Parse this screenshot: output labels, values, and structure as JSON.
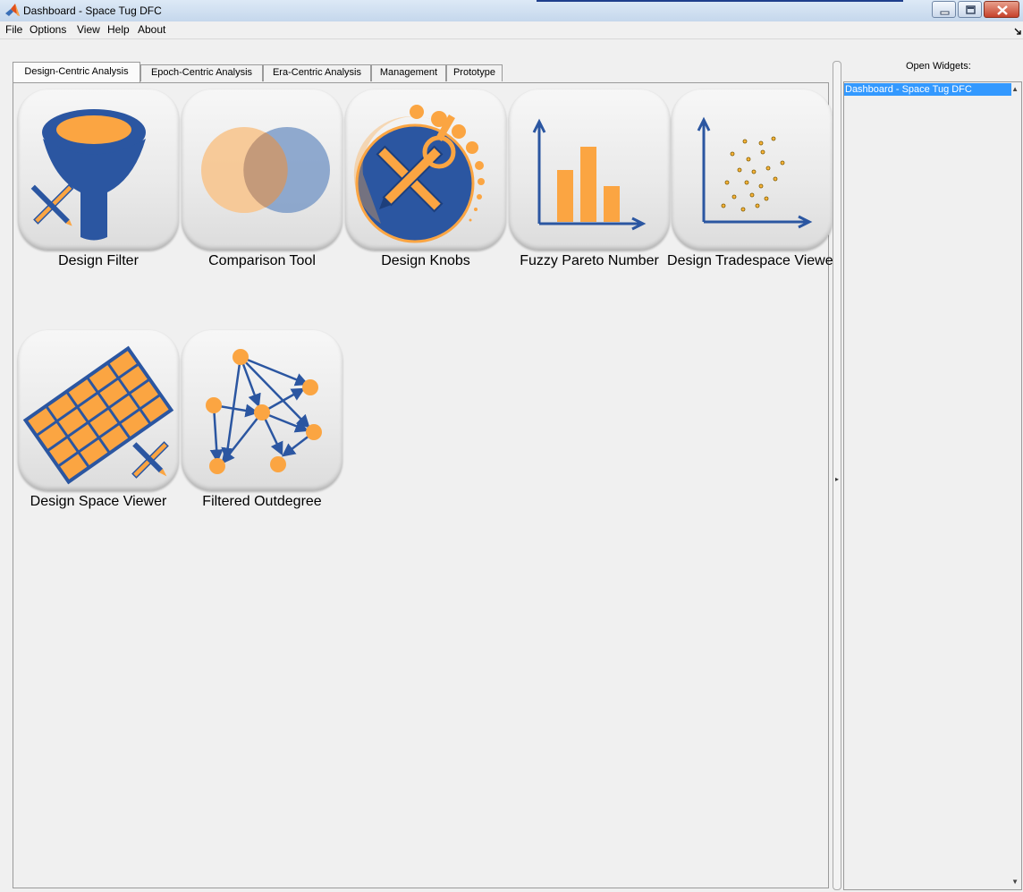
{
  "window": {
    "title": "Dashboard - Space Tug DFC"
  },
  "menu": [
    "File",
    "Options",
    "View",
    "Help",
    "About"
  ],
  "tabs": [
    {
      "label": "Design-Centric Analysis",
      "active": true
    },
    {
      "label": "Epoch-Centric Analysis",
      "active": false
    },
    {
      "label": "Era-Centric Analysis",
      "active": false
    },
    {
      "label": "Management",
      "active": false
    },
    {
      "label": "Prototype",
      "active": false
    }
  ],
  "tools": [
    {
      "label": "Design Filter",
      "icon": "funnel-icon"
    },
    {
      "label": "Comparison Tool",
      "icon": "venn-icon"
    },
    {
      "label": "Design Knobs",
      "icon": "knob-icon"
    },
    {
      "label": "Fuzzy Pareto Number",
      "icon": "bar-chart-icon"
    },
    {
      "label": "Design Tradespace Viewer",
      "icon": "scatter-plot-icon"
    },
    {
      "label": "Design Space Viewer",
      "icon": "grid-icon"
    },
    {
      "label": "Filtered Outdegree",
      "icon": "network-graph-icon"
    }
  ],
  "right_panel": {
    "header": "Open Widgets:",
    "items": [
      "Dashboard - Space Tug DFC"
    ]
  },
  "colors": {
    "accent_orange": "#fba542",
    "accent_blue": "#2b56a1",
    "selection": "#3399ff"
  }
}
